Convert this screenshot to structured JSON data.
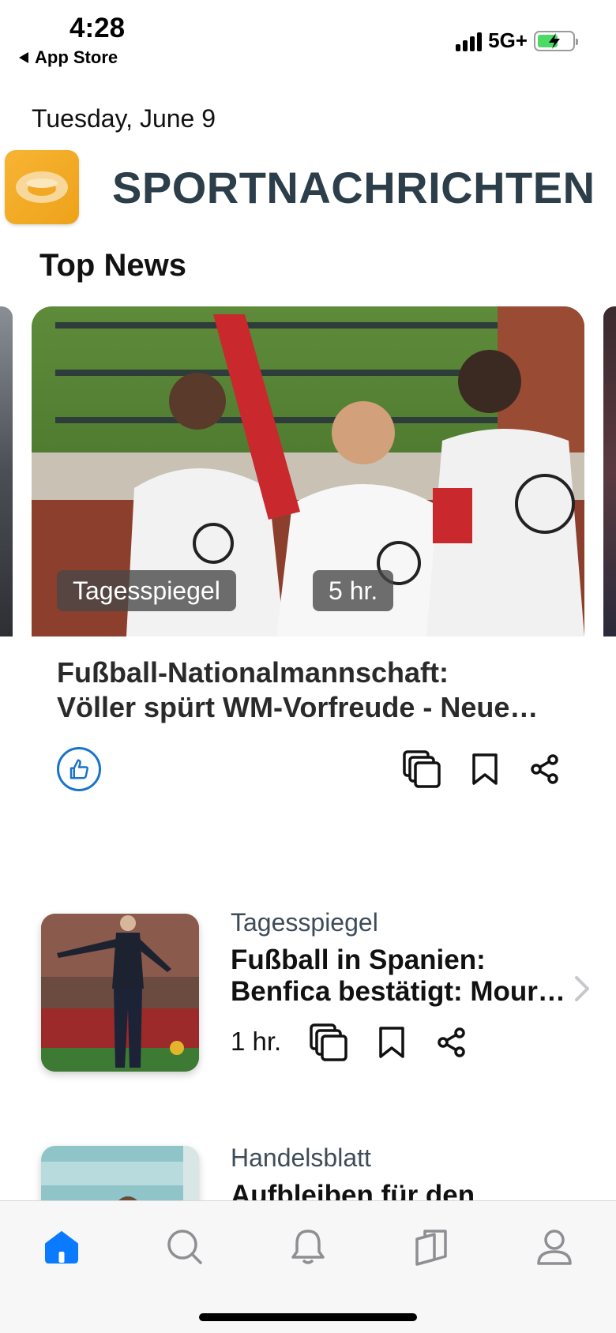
{
  "status_bar": {
    "time": "4:28",
    "back_label": "App Store",
    "network": "5G+",
    "battery_level": 0.6
  },
  "header": {
    "date": "Tuesday, June 9",
    "brand": "SPORTNACHRICHTEN",
    "logo_icon": "stadium-logo-icon"
  },
  "top_news": {
    "section_title": "Top News",
    "featured": {
      "source": "Tagesspiegel",
      "time": "5 hr.",
      "headline_line1": "Fußball-Nationalmannschaft:",
      "headline_line2": "Völler spürt WM-Vorfreude - Neue…",
      "actions": [
        "like-icon",
        "copy-icon",
        "bookmark-icon",
        "share-icon"
      ]
    }
  },
  "articles": [
    {
      "source": "Tagesspiegel",
      "title_line1": "Fußball in Spanien:",
      "title_line2": "Benfica bestätigt: Mour…",
      "time": "1 hr."
    },
    {
      "source": "Handelsblatt",
      "title_line1": "Aufbleiben für den",
      "title_line2": ""
    }
  ],
  "tab_bar": {
    "tabs": [
      "home-icon",
      "search-icon",
      "bell-icon",
      "cards-icon",
      "profile-icon"
    ],
    "active": "home-icon",
    "accent": "#0a7aff"
  },
  "colors": {
    "brand_text": "#2c3e4a",
    "logo": "#f2a823",
    "like_accent": "#1a73c9"
  }
}
